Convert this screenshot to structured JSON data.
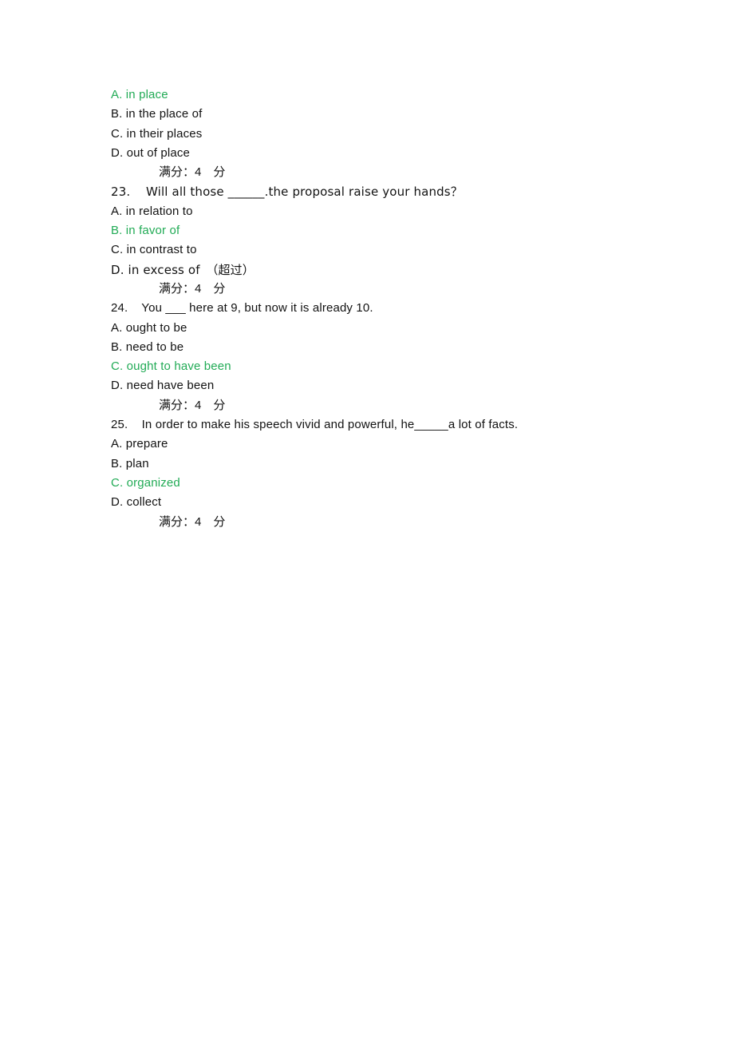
{
  "document": {
    "type": "exam-answer-key",
    "background_color": "#ffffff",
    "text_color": "#121212",
    "correct_answer_color": "#22ab56"
  },
  "score_line": {
    "text": "满分：4　分",
    "label": "满分",
    "separator": "：",
    "value": "4",
    "unit": "分"
  },
  "questions": [
    {
      "number": "",
      "prompt": "",
      "options": [
        {
          "label": "A.",
          "text": "in place",
          "full": "A. in place",
          "correct": true
        },
        {
          "label": "B.",
          "text": "in the place of",
          "full": "B. in the place of",
          "correct": false
        },
        {
          "label": "C.",
          "text": "in their places",
          "full": "C. in their places",
          "correct": false
        },
        {
          "label": "D.",
          "text": "out of place",
          "full": "D. out of place",
          "correct": false
        }
      ],
      "score": "满分：4　分"
    },
    {
      "number": "23.",
      "prompt": "23.    Will all those ______.the proposal raise your hands？",
      "prompt_body": "Will all those ______.the proposal raise your hands？",
      "options": [
        {
          "label": "A.",
          "text": "in relation to",
          "full": "A. in relation to",
          "correct": false
        },
        {
          "label": "B.",
          "text": "in favor of",
          "full": "B. in favor of",
          "correct": true
        },
        {
          "label": "C.",
          "text": "in contrast to",
          "full": "C. in contrast to",
          "correct": false
        },
        {
          "label": "D.",
          "text": "in excess of （超过）",
          "full": "D. in excess of　（超过）",
          "correct": false
        }
      ],
      "score": "满分：4　分"
    },
    {
      "number": "24.",
      "prompt": "24.    You ___ here at 9, but now it is already 10.",
      "prompt_body": "You ___ here at 9, but now it is already 10.",
      "options": [
        {
          "label": "A.",
          "text": "ought to be",
          "full": "A. ought to be",
          "correct": false
        },
        {
          "label": "B.",
          "text": "need to be",
          "full": "B. need to be",
          "correct": false
        },
        {
          "label": "C.",
          "text": "ought to have been",
          "full": "C. ought to have been",
          "correct": true
        },
        {
          "label": "D.",
          "text": "need have been",
          "full": "D. need have been",
          "correct": false
        }
      ],
      "score": "满分：4　分"
    },
    {
      "number": "25.",
      "prompt": "25.    In order to make his speech vivid and powerful, he_____a lot of facts.",
      "prompt_body": "In order to make his speech vivid and powerful, he_____a lot of facts.",
      "options": [
        {
          "label": "A.",
          "text": "prepare",
          "full": "A. prepare",
          "correct": false
        },
        {
          "label": "B.",
          "text": "plan",
          "full": "B. plan",
          "correct": false
        },
        {
          "label": "C.",
          "text": "organized",
          "full": "C. organized",
          "correct": true
        },
        {
          "label": "D.",
          "text": "collect",
          "full": "D. collect",
          "correct": false
        }
      ],
      "score": "满分：4　分"
    }
  ]
}
